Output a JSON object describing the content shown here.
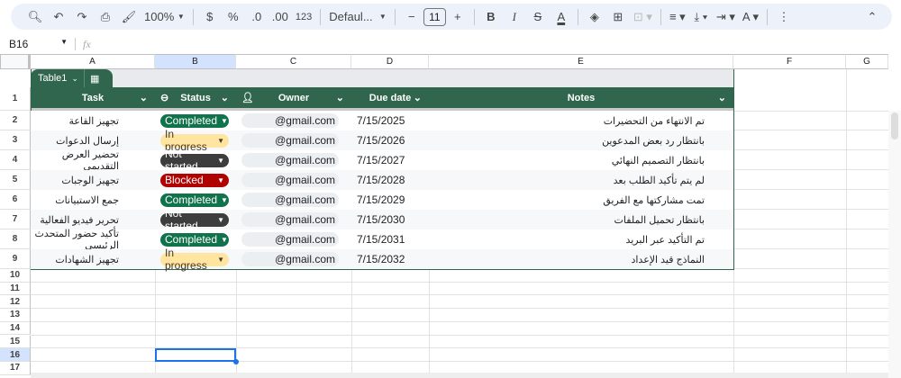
{
  "toolbar": {
    "zoom": "100%",
    "currency": "$",
    "percent": "%",
    "dec_decrease": ".0",
    "dec_increase": ".00",
    "format_number": "123",
    "font": "Defaul...",
    "font_size": "11",
    "minus": "−",
    "plus": "+",
    "bold": "B",
    "italic": "I"
  },
  "formula_bar": {
    "cell_ref": "B16",
    "fx": "fx"
  },
  "columns": [
    "A",
    "B",
    "C",
    "D",
    "E",
    "F",
    "G"
  ],
  "row_numbers": [
    "1",
    "2",
    "3",
    "4",
    "5",
    "6",
    "7",
    "8",
    "9",
    "10",
    "11",
    "12",
    "13",
    "14",
    "15",
    "16",
    "17"
  ],
  "table": {
    "name": "Table1",
    "headers": [
      "Task",
      "Status",
      "Owner",
      "Due date",
      "Notes"
    ],
    "rows": [
      {
        "task": "تجهيز القاعة",
        "status": "Completed",
        "owner": "@gmail.com",
        "due": "7/15/2025",
        "notes": "تم الانتهاء من التحضيرات"
      },
      {
        "task": "إرسال الدعوات",
        "status": "In progress",
        "owner": "@gmail.com",
        "due": "7/15/2026",
        "notes": "بانتظار رد بعض المدعوين"
      },
      {
        "task": "تحضير العرض التقديمي",
        "status": "Not started",
        "owner": "@gmail.com",
        "due": "7/15/2027",
        "notes": "بانتظار التصميم النهائي"
      },
      {
        "task": "تجهيز الوجبات",
        "status": "Blocked",
        "owner": "@gmail.com",
        "due": "7/15/2028",
        "notes": "لم يتم تأكيد الطلب بعد"
      },
      {
        "task": "جمع الاستبيانات",
        "status": "Completed",
        "owner": "@gmail.com",
        "due": "7/15/2029",
        "notes": "تمت مشاركتها مع الفريق"
      },
      {
        "task": "تحرير فيديو الفعالية",
        "status": "Not started",
        "owner": "@gmail.com",
        "due": "7/15/2030",
        "notes": "بانتظار تحميل الملفات"
      },
      {
        "task": "تأكيد حضور المتحدث الرئيسي",
        "status": "Completed",
        "owner": "@gmail.com",
        "due": "7/15/2031",
        "notes": "تم التأكيد عبر البريد"
      },
      {
        "task": "تجهيز الشهادات",
        "status": "In progress",
        "owner": "@gmail.com",
        "due": "7/15/2032",
        "notes": "النماذج قيد الإعداد"
      }
    ]
  },
  "status_colors": {
    "Completed": [
      "#11734b",
      "#ffffff"
    ],
    "In progress": [
      "#ffe5a0",
      "#473821"
    ],
    "Not started": [
      "#3d3d3d",
      "#ffffff"
    ],
    "Blocked": [
      "#b10202",
      "#ffffff"
    ]
  },
  "header_color": "#30664e"
}
